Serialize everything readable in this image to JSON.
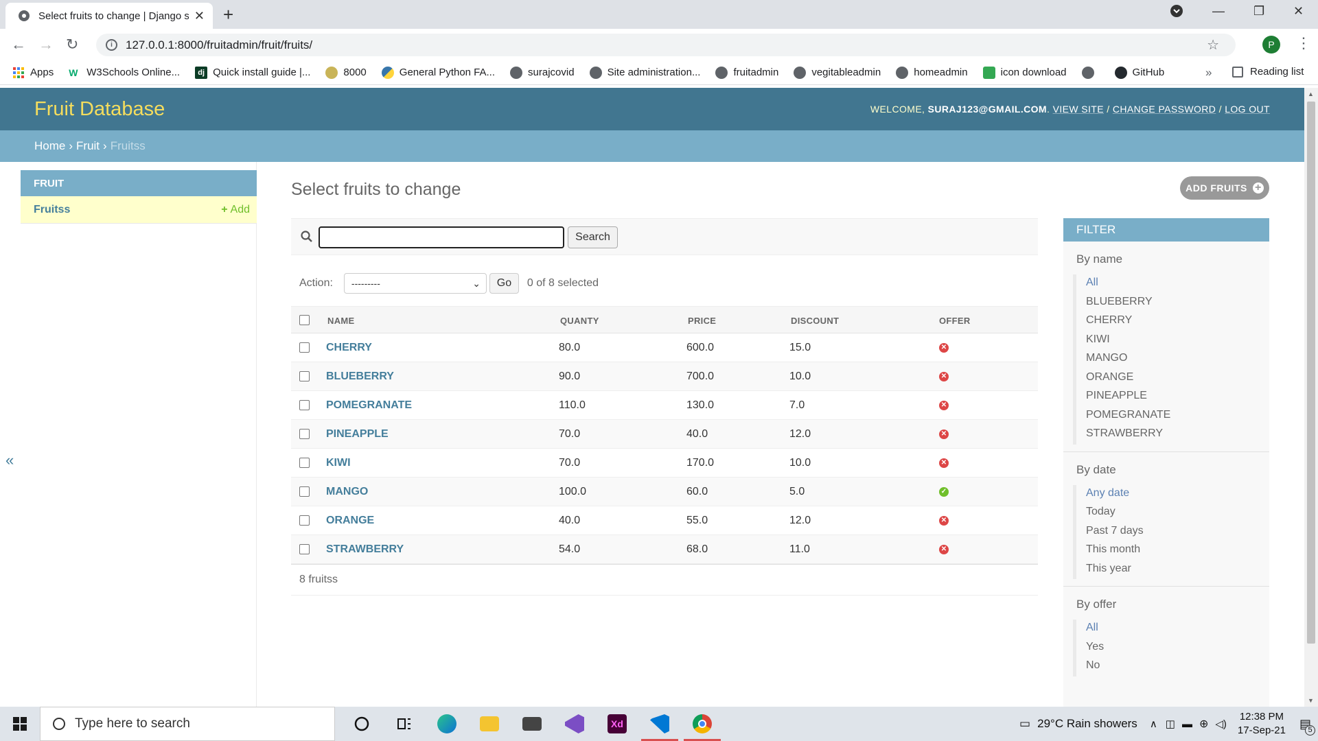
{
  "browser": {
    "tab_title": "Select fruits to change | Django s",
    "url": "127.0.0.1:8000/fruitadmin/fruit/fruits/",
    "profile_initial": "P",
    "bookmarks": [
      {
        "label": "Apps",
        "icon": "grid"
      },
      {
        "label": "W3Schools Online...",
        "icon": "w3"
      },
      {
        "label": "Quick install guide |...",
        "icon": "dj"
      },
      {
        "label": "8000",
        "icon": "bee"
      },
      {
        "label": "General Python FA...",
        "icon": "py"
      },
      {
        "label": "surajcovid",
        "icon": "globe"
      },
      {
        "label": "Site administration...",
        "icon": "globe"
      },
      {
        "label": "fruitadmin",
        "icon": "globe"
      },
      {
        "label": "vegitableadmin",
        "icon": "globe"
      },
      {
        "label": "homeadmin",
        "icon": "globe"
      },
      {
        "label": "icon download",
        "icon": "sq"
      },
      {
        "label": "",
        "icon": "globe"
      },
      {
        "label": "GitHub",
        "icon": "gh"
      }
    ],
    "more_label": "»",
    "reading_list": "Reading list"
  },
  "admin": {
    "brand": "Fruit Database",
    "welcome": "WELCOME,",
    "user": "SURAJ123@GMAIL.COM",
    "view_site": "VIEW SITE",
    "change_password": "CHANGE PASSWORD",
    "log_out": "LOG OUT",
    "sep1": ".",
    "sep2": "/",
    "sep3": "/",
    "breadcrumbs": {
      "home": "Home",
      "app": "Fruit",
      "current": "Fruitss",
      "sep": "›"
    },
    "sidebar": {
      "module": "FRUIT",
      "model": "Fruitss",
      "add": "Add",
      "collapse": "«"
    },
    "page_title": "Select fruits to change",
    "add_button": "ADD FRUITS",
    "search_button": "Search",
    "action_label": "Action:",
    "action_value": "---------",
    "go_button": "Go",
    "selected_count": "0 of 8 selected",
    "columns": [
      "NAME",
      "QUANTY",
      "PRICE",
      "DISCOUNT",
      "OFFER"
    ],
    "rows": [
      {
        "name": "CHERRY",
        "quanty": "80.0",
        "price": "600.0",
        "discount": "15.0",
        "offer": false
      },
      {
        "name": "BLUEBERRY",
        "quanty": "90.0",
        "price": "700.0",
        "discount": "10.0",
        "offer": false
      },
      {
        "name": "POMEGRANATE",
        "quanty": "110.0",
        "price": "130.0",
        "discount": "7.0",
        "offer": false
      },
      {
        "name": "PINEAPPLE",
        "quanty": "70.0",
        "price": "40.0",
        "discount": "12.0",
        "offer": false
      },
      {
        "name": "KIWI",
        "quanty": "70.0",
        "price": "170.0",
        "discount": "10.0",
        "offer": false
      },
      {
        "name": "MANGO",
        "quanty": "100.0",
        "price": "60.0",
        "discount": "5.0",
        "offer": true
      },
      {
        "name": "ORANGE",
        "quanty": "40.0",
        "price": "55.0",
        "discount": "12.0",
        "offer": false
      },
      {
        "name": "STRAWBERRY",
        "quanty": "54.0",
        "price": "68.0",
        "discount": "11.0",
        "offer": false
      }
    ],
    "paginator": "8 fruitss",
    "filter": {
      "title": "FILTER",
      "groups": [
        {
          "title": "By name",
          "items": [
            "All",
            "BLUEBERRY",
            "CHERRY",
            "KIWI",
            "MANGO",
            "ORANGE",
            "PINEAPPLE",
            "POMEGRANATE",
            "STRAWBERRY"
          ],
          "selected": 0
        },
        {
          "title": "By date",
          "items": [
            "Any date",
            "Today",
            "Past 7 days",
            "This month",
            "This year"
          ],
          "selected": 0
        },
        {
          "title": "By offer",
          "items": [
            "All",
            "Yes",
            "No"
          ],
          "selected": 0
        }
      ]
    }
  },
  "taskbar": {
    "search_placeholder": "Type here to search",
    "weather": "29°C  Rain showers",
    "time": "12:38 PM",
    "date": "17-Sep-21",
    "notifications": "5"
  },
  "colors": {
    "header": "#417690",
    "breadcrumbs": "#79aec8",
    "brand": "#f5dd5d",
    "link": "#447e9b",
    "offer_no": "#dd4646",
    "offer_yes": "#70bf2b"
  }
}
